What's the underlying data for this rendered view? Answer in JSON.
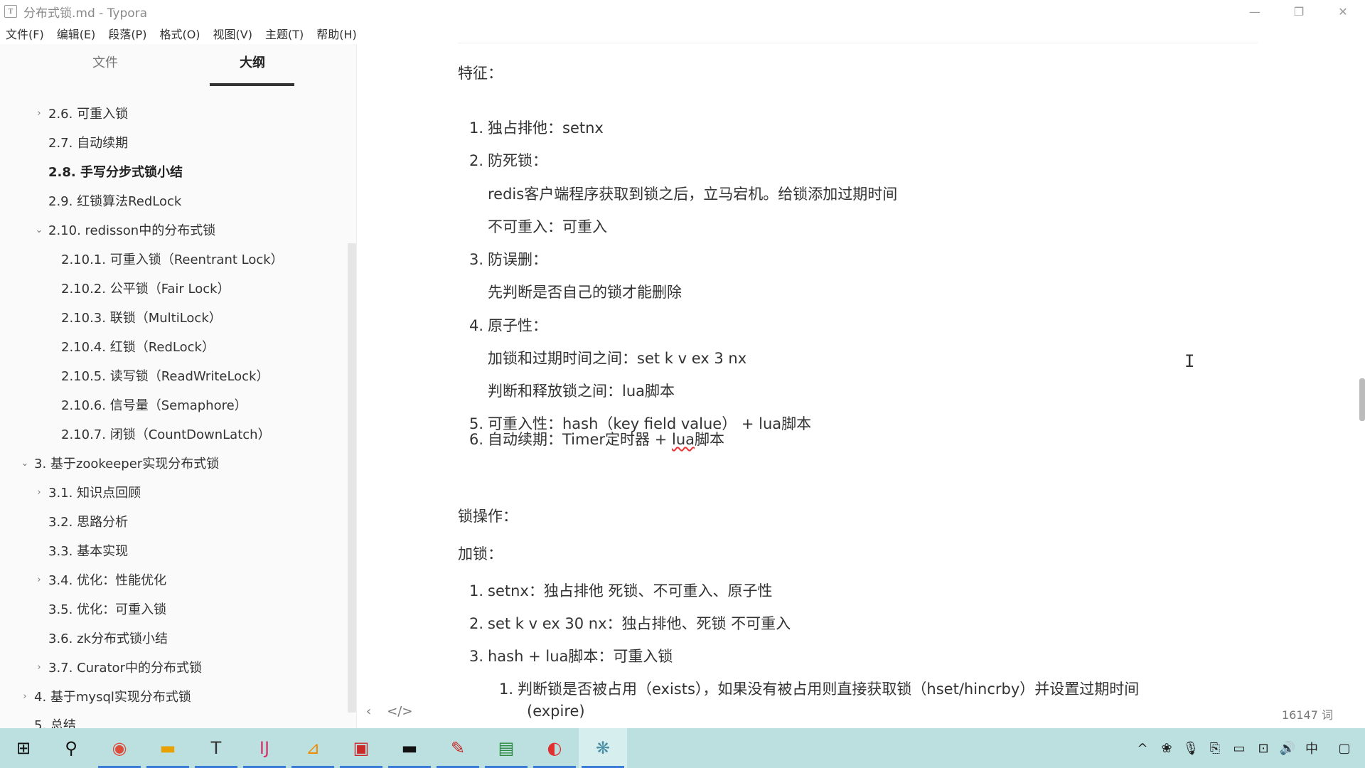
{
  "window": {
    "app_icon": "T",
    "title": "分布式锁.md - Typora",
    "controls": {
      "minimize": "—",
      "restore": "❐",
      "close": "✕"
    }
  },
  "menu": [
    "文件(F)",
    "编辑(E)",
    "段落(P)",
    "格式(O)",
    "视图(V)",
    "主题(T)",
    "帮助(H)"
  ],
  "sidebar": {
    "tabs": {
      "files": "文件",
      "outline": "大纲"
    },
    "outline": [
      {
        "text": "2.6. 可重入锁",
        "chev": "›",
        "level": 2
      },
      {
        "text": "2.7. 自动续期",
        "chev": "",
        "level": 2
      },
      {
        "text": "2.8. 手写分步式锁小结",
        "chev": "",
        "level": 2,
        "active": true
      },
      {
        "text": "2.9. 红锁算法RedLock",
        "chev": "",
        "level": 2
      },
      {
        "text": "2.10. redisson中的分布式锁",
        "chev": "⌄",
        "level": 2
      },
      {
        "text": "2.10.1. 可重入锁（Reentrant Lock）",
        "chev": "",
        "level": 3
      },
      {
        "text": "2.10.2. 公平锁（Fair Lock）",
        "chev": "",
        "level": 3
      },
      {
        "text": "2.10.3. 联锁（MultiLock）",
        "chev": "",
        "level": 3
      },
      {
        "text": "2.10.4. 红锁（RedLock）",
        "chev": "",
        "level": 3
      },
      {
        "text": "2.10.5. 读写锁（ReadWriteLock）",
        "chev": "",
        "level": 3
      },
      {
        "text": "2.10.6. 信号量（Semaphore）",
        "chev": "",
        "level": 3
      },
      {
        "text": "2.10.7. 闭锁（CountDownLatch）",
        "chev": "",
        "level": 3
      },
      {
        "text": "3. 基于zookeeper实现分布式锁",
        "chev": "⌄",
        "level": 1
      },
      {
        "text": "3.1. 知识点回顾",
        "chev": "›",
        "level": 2
      },
      {
        "text": "3.2. 思路分析",
        "chev": "",
        "level": 2
      },
      {
        "text": "3.3. 基本实现",
        "chev": "",
        "level": 2
      },
      {
        "text": "3.4. 优化：性能优化",
        "chev": "›",
        "level": 2
      },
      {
        "text": "3.5. 优化：可重入锁",
        "chev": "",
        "level": 2
      },
      {
        "text": "3.6. zk分布式锁小结",
        "chev": "",
        "level": 2
      },
      {
        "text": "3.7. Curator中的分布式锁",
        "chev": "›",
        "level": 2
      },
      {
        "text": "4. 基于mysql实现分布式锁",
        "chev": "›",
        "level": 1
      },
      {
        "text": "5. 总结",
        "chev": "",
        "level": 1
      }
    ]
  },
  "editor": {
    "features_heading": "特征：",
    "features": [
      {
        "num": "1.",
        "text": "独占排他：setnx"
      },
      {
        "num": "2.",
        "text": "防死锁："
      },
      {
        "num": "",
        "text": "redis客户端程序获取到锁之后，立马宕机。给锁添加过期时间"
      },
      {
        "num": "",
        "text": "不可重入：可重入"
      },
      {
        "num": "3.",
        "text": "防误删："
      },
      {
        "num": "",
        "text": "先判断是否自己的锁才能删除"
      },
      {
        "num": "4.",
        "text": "原子性："
      },
      {
        "num": "",
        "text": "加锁和过期时间之间：set k v ex 3 nx"
      },
      {
        "num": "",
        "text": "判断和释放锁之间：lua脚本"
      },
      {
        "num": "5.",
        "text": "可重入性：hash（key field value） + lua脚本"
      }
    ],
    "item6": {
      "num": "6.",
      "pre": "自动续期：Timer定时器 + ",
      "squiggle": "lua",
      "post": "脚本"
    },
    "lock_ops_heading": "锁操作：",
    "lock_heading": "加锁：",
    "lock_steps": [
      {
        "num": "1.",
        "text": "setnx：独占排他   死锁、不可重入、原子性"
      },
      {
        "num": "2.",
        "text": "set k v ex 30 nx：独占排他、死锁         不可重入"
      },
      {
        "num": "3.",
        "text": "hash + lua脚本：可重入锁"
      }
    ],
    "sub_step": {
      "num": "1.",
      "text": "判断锁是否被占用（exists），如果没有被占用则直接获取锁（hset/hincrby）并设置过期时间",
      "cont": "(expire)"
    },
    "cursor": "I"
  },
  "statusbar": {
    "back_icon": "‹",
    "source_icon": "</>",
    "word_count": "16147 词"
  },
  "taskbar": {
    "icons": [
      "windows-start-icon",
      "search-icon",
      "chrome-icon",
      "file-explorer-icon",
      "typora-icon",
      "intellij-icon",
      "app-icon",
      "app-red-icon",
      "terminal-icon",
      "pen-icon",
      "notepad-icon",
      "redis-icon",
      "feishu-icon"
    ],
    "glyphs": [
      "⊞",
      "⚲",
      "◉",
      "▬",
      "T",
      "IJ",
      "⊿",
      "▣",
      "▬",
      "✎",
      "▤",
      "◐",
      "❋"
    ],
    "tray_glyphs": [
      "^",
      "❀",
      "🎙",
      "⎘",
      "▭",
      "⊡",
      "🔊",
      "中",
      "▢"
    ]
  }
}
